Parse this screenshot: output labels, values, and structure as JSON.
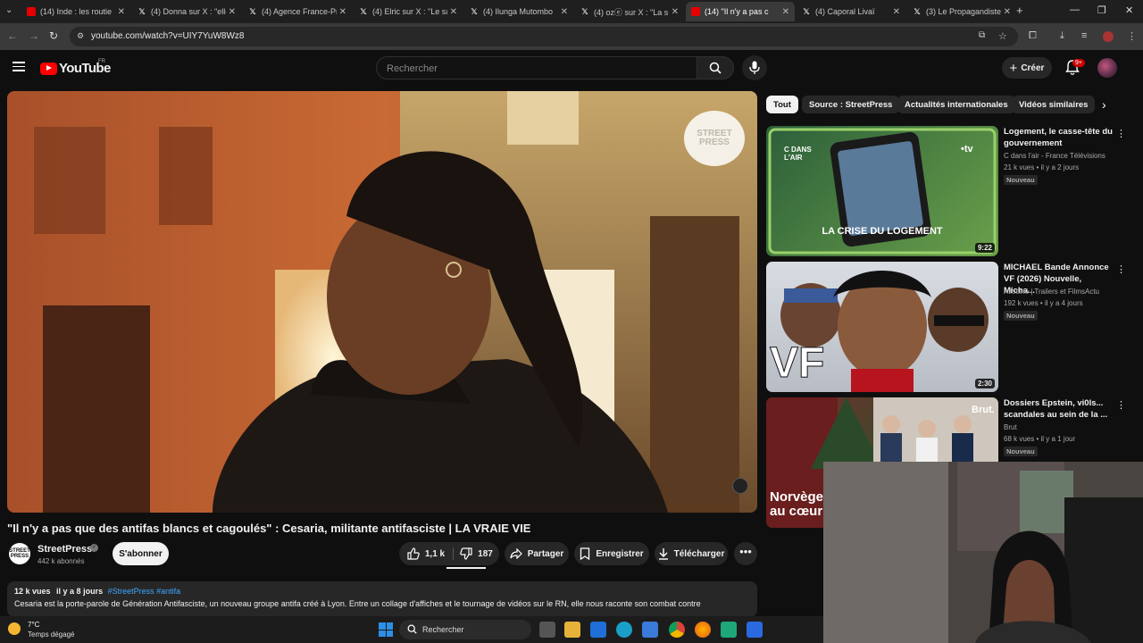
{
  "browser": {
    "tabs": [
      {
        "label": "(14) Inde : les routie",
        "kind": "yt"
      },
      {
        "label": "(4) Donna sur X : \"elle",
        "kind": "x"
      },
      {
        "label": "(4) Agence France-Pr",
        "kind": "x"
      },
      {
        "label": "(4) Elric sur X : \"Le sa",
        "kind": "x"
      },
      {
        "label": "(4) Ilunga Mutombo",
        "kind": "x"
      },
      {
        "label": "(4) ozⓔ sur X : \"La s",
        "kind": "x"
      },
      {
        "label": "(14) \"Il n'y a pas c",
        "kind": "yt"
      },
      {
        "label": "(4) Caporal Livaï",
        "kind": "x"
      },
      {
        "label": "(3) Le Propagandiste",
        "kind": "x"
      }
    ],
    "url": "youtube.com/watch?v=UIY7YuW8Wz8",
    "new_tab": "+"
  },
  "youtube": {
    "logo_text": "YouTube",
    "region": "FR",
    "search_placeholder": "Rechercher",
    "create_label": "Créer",
    "notif_count": "9+"
  },
  "video": {
    "watermark": "STREET PRESS",
    "title": "\"Il n'y a pas que des antifas blancs et cagoulés\" : Cesaria, militante antifasciste | LA VRAIE VIE",
    "channel": {
      "avatar_text": "STREET PRESS",
      "name": "StreetPress",
      "verified": "✓",
      "subscribers": "442 k abonnés"
    },
    "subscribe_label": "S'abonner",
    "likes": "1,1 k",
    "dislikes": "187",
    "share_label": "Partager",
    "save_label": "Enregistrer",
    "download_label": "Télécharger",
    "more": "•••",
    "description": {
      "views": "12 k vues",
      "date": "il y a 8 jours",
      "tags": "#StreetPress #antifa",
      "text": "Cesaria est la porte-parole de Génération Antifasciste, un nouveau groupe antifa créé à Lyon. Entre un collage d'affiches et le tournage de vidéos sur le RN, elle nous raconte son combat contre"
    }
  },
  "chips": [
    "Tout",
    "Source : StreetPress",
    "Actualités internationales",
    "Vidéos similaires"
  ],
  "recommendations": [
    {
      "title": "Logement, le casse-tête du gouvernement",
      "channel": "C dans l'air - France Télévisions",
      "meta": "21 k vues • il y a 2 jours",
      "badge": "Nouveau",
      "duration": "9:22",
      "thumb_brand": "C DANS L'AIR",
      "thumb_logo": "•tv",
      "thumb_caption": "LA CRISE DU LOGEMENT"
    },
    {
      "title": "MICHAEL Bande Annonce VF (2026) Nouvelle, Micha...",
      "channel": "Allociné | Trailers et FilmsActu",
      "meta": "192 k vues • il y a 4 jours",
      "badge": "Nouveau",
      "duration": "2:30",
      "thumb_caption": "VF"
    },
    {
      "title": "Dossiers Epstein, vi0ls... scandales au sein de la ...",
      "channel": "Brut",
      "meta": "68 k vues • il y a 1 jour",
      "badge": "Nouveau",
      "thumb_brand": "Brut.",
      "thumb_caption": "Norvège au cœur"
    }
  ],
  "taskbar": {
    "temp": "7°C",
    "weather": "Temps dégagé",
    "search_label": "Rechercher"
  },
  "colors": {
    "accent": "#ff0000",
    "link": "#3ea6ff",
    "bg": "#0f0f0f",
    "surface": "#272727"
  }
}
